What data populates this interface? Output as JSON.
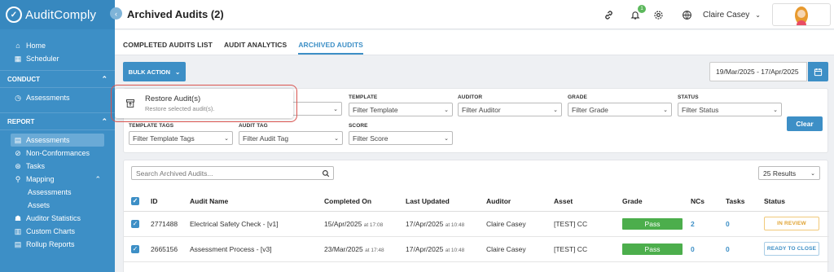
{
  "brand": {
    "name": "AuditComply"
  },
  "sidebar": {
    "top_items": [
      {
        "label": "Home",
        "icon": "home-icon"
      },
      {
        "label": "Scheduler",
        "icon": "calendar-icon"
      }
    ],
    "conduct": {
      "title": "CONDUCT",
      "items": [
        {
          "label": "Assessments",
          "icon": "clock-icon"
        }
      ]
    },
    "report": {
      "title": "REPORT",
      "items": [
        {
          "label": "Assessments",
          "icon": "list-icon"
        },
        {
          "label": "Non-Conformances",
          "icon": "nc-icon"
        },
        {
          "label": "Tasks",
          "icon": "tasks-icon"
        },
        {
          "label": "Mapping",
          "icon": "pin-icon"
        },
        {
          "label": "Assessments",
          "icon": ""
        },
        {
          "label": "Assets",
          "icon": ""
        },
        {
          "label": "Auditor Statistics",
          "icon": "users-icon"
        },
        {
          "label": "Custom Charts",
          "icon": "chart-icon"
        },
        {
          "label": "Rollup Reports",
          "icon": "rollup-icon"
        }
      ]
    }
  },
  "header": {
    "title": "Archived Audits (2)",
    "user_name": "Claire Casey",
    "notifications": "1"
  },
  "tabs": [
    "COMPLETED AUDITS LIST",
    "AUDIT ANALYTICS",
    "ARCHIVED AUDITS"
  ],
  "toolbar": {
    "bulk_action": "BULK ACTION",
    "date_range": "19/Mar/2025 - 17/Apr/2025"
  },
  "popup": {
    "title": "Restore Audit(s)",
    "subtitle": "Restore selected audit(s)."
  },
  "filters": {
    "template": {
      "label": "TEMPLATE",
      "value": "Filter Template"
    },
    "auditor": {
      "label": "AUDITOR",
      "value": "Filter Auditor"
    },
    "grade": {
      "label": "GRADE",
      "value": "Filter Grade"
    },
    "status": {
      "label": "STATUS",
      "value": "Filter Status"
    },
    "template_tags": {
      "label": "TEMPLATE TAGS",
      "value": "Filter Template Tags"
    },
    "audit_tag": {
      "label": "AUDIT TAG",
      "value": "Filter Audit Tag"
    },
    "score": {
      "label": "SCORE",
      "value": "Filter Score"
    },
    "clear": "Clear"
  },
  "table": {
    "search_placeholder": "Search Archived Audits...",
    "page_size": "25 Results",
    "headers": [
      "ID",
      "Audit Name",
      "Completed On",
      "Last Updated",
      "Auditor",
      "Asset",
      "Grade",
      "NCs",
      "Tasks",
      "Status"
    ],
    "rows": [
      {
        "id": "2771488",
        "name": "Electrical Safety Check - [v1]",
        "completed_date": "15/Apr/2025",
        "completed_time": "at 17:08",
        "updated_date": "17/Apr/2025",
        "updated_time": "at 10:48",
        "auditor": "Claire Casey",
        "asset": "[TEST] CC",
        "grade": "Pass",
        "ncs": "2",
        "tasks": "0",
        "status": "IN REVIEW"
      },
      {
        "id": "2665156",
        "name": "Assessment Process - [v3]",
        "completed_date": "23/Mar/2025",
        "completed_time": "at 17:48",
        "updated_date": "17/Apr/2025",
        "updated_time": "at 10:48",
        "auditor": "Claire Casey",
        "asset": "[TEST] CC",
        "grade": "Pass",
        "ncs": "0",
        "tasks": "0",
        "status": "READY TO CLOSE"
      }
    ]
  },
  "colors": {
    "accent": "#3d8fc6",
    "sidebar": "#3d8fc6",
    "pass": "#4cae4c",
    "review": "#e0a435",
    "highlight": "#d9534f"
  }
}
